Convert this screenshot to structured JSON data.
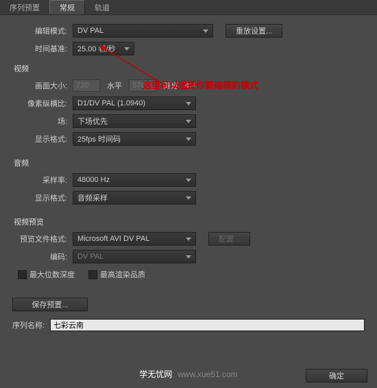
{
  "tabs": {
    "preset": "序列预置",
    "general": "常规",
    "track": "轨道"
  },
  "editMode": {
    "label": "编辑模式:",
    "value": "DV PAL"
  },
  "resetBtn": "重放设置...",
  "timebase": {
    "label": "时间基准:",
    "value": "25.00 帧/秒"
  },
  "videoSection": "视频",
  "frameSize": {
    "label": "画面大小:",
    "w": "720",
    "hLabel": "水平",
    "h": "576",
    "vLabel": "垂直",
    "ratio": "4:3"
  },
  "par": {
    "label": "像素纵横比:",
    "value": "D1/DV PAL (1.0940)"
  },
  "field": {
    "label": "场:",
    "value": "下场优先"
  },
  "dispFmt": {
    "label": "显示格式:",
    "value": "25fps 时间码"
  },
  "audioSection": "音频",
  "sampleRate": {
    "label": "采样率:",
    "value": "48000 Hz"
  },
  "audioDisp": {
    "label": "显示格式:",
    "value": "音频采样"
  },
  "previewSection": "视频预览",
  "previewFmt": {
    "label": "预览文件格式:",
    "value": "Microsoft AVI DV PAL"
  },
  "configBtn": "配置...",
  "encode": {
    "label": "编码:",
    "value": "DV PAL"
  },
  "maxBitDepth": "最大位数深度",
  "maxRender": "最高渲染品质",
  "savePreset": "保存预置...",
  "seqName": {
    "label": "序列名称:",
    "value": "七彩云南"
  },
  "annotation": "这里可以选择你要编辑的模式",
  "watermark": {
    "text1": "学无忧网",
    "text2": "www.xue51.com"
  },
  "okBtn": "确定"
}
